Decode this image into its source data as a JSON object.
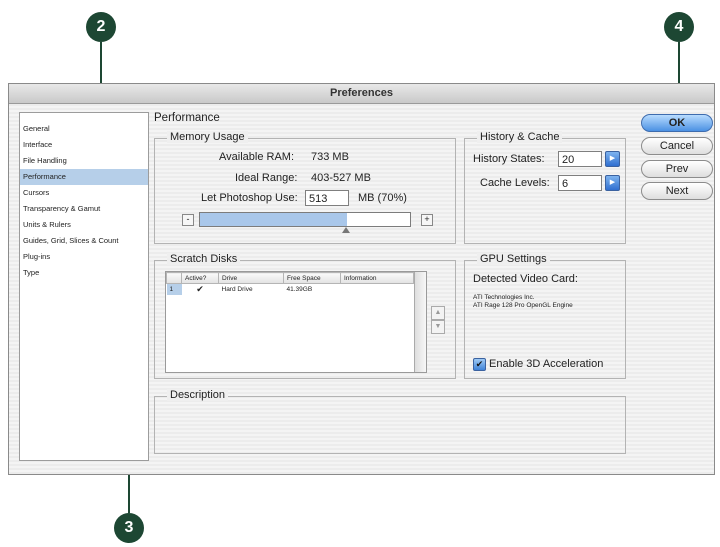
{
  "window": {
    "title": "Preferences"
  },
  "sidebar": {
    "items": [
      {
        "label": "General"
      },
      {
        "label": "Interface"
      },
      {
        "label": "File Handling"
      },
      {
        "label": "Performance"
      },
      {
        "label": "Cursors"
      },
      {
        "label": "Transparency & Gamut"
      },
      {
        "label": "Units & Rulers"
      },
      {
        "label": "Guides, Grid, Slices & Count"
      },
      {
        "label": "Plug-ins"
      },
      {
        "label": "Type"
      }
    ],
    "selected": "Performance"
  },
  "main": {
    "heading": "Performance",
    "memory": {
      "title": "Memory Usage",
      "available_label": "Available RAM:",
      "available_value": "733 MB",
      "ideal_label": "Ideal Range:",
      "ideal_value": "403-527 MB",
      "use_label": "Let Photoshop Use:",
      "use_value": "513",
      "use_unit": "MB (70%)",
      "slider_fraction": 0.7,
      "minus": "-",
      "plus": "+"
    },
    "history": {
      "title": "History & Cache",
      "states_label": "History States:",
      "states_value": "20",
      "cache_label": "Cache Levels:",
      "cache_value": "6"
    },
    "scratch": {
      "title": "Scratch Disks",
      "columns": [
        "Active?",
        "Drive",
        "Free Space",
        "Information"
      ],
      "rows": [
        {
          "index": "1",
          "active": "✔",
          "drive": "Hard Drive",
          "free": "41.39GB",
          "info": ""
        }
      ],
      "up_arrow": "▲",
      "down_arrow": "▼"
    },
    "gpu": {
      "title": "GPU Settings",
      "detected_label": "Detected Video Card:",
      "card_line1": "ATI Technologies Inc.",
      "card_line2": "ATI Rage 128 Pro OpenGL Engine",
      "enable_label": "Enable 3D Acceleration",
      "enable_checked": true,
      "check_glyph": "✔"
    },
    "description": {
      "title": "Description"
    }
  },
  "buttons": {
    "ok": "OK",
    "cancel": "Cancel",
    "prev": "Prev",
    "next": "Next"
  },
  "callouts": {
    "c2": "2",
    "c3": "3",
    "c4": "4"
  },
  "colors": {
    "callout": "#1d4733",
    "selection": "#b6cfe9",
    "accent": "#4b91e3"
  }
}
